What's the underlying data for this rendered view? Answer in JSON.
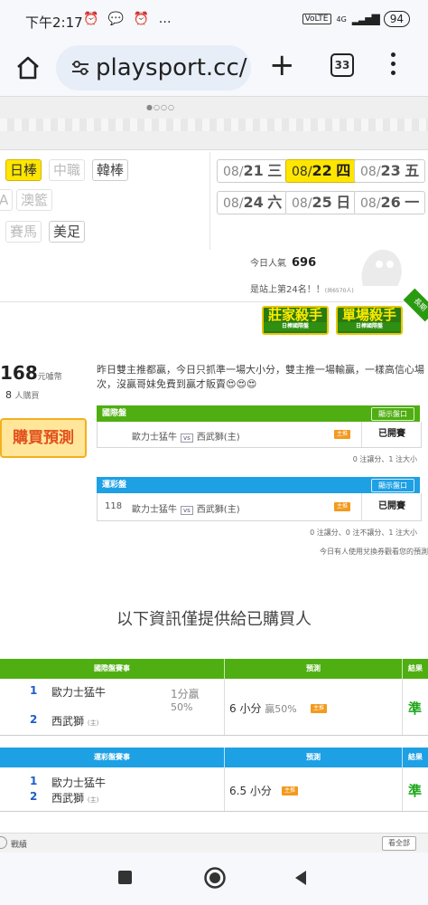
{
  "status": {
    "time": "下午2:17",
    "icons": "⏰ 💬 ⏰ …",
    "network": "4G",
    "battery": "94"
  },
  "browser": {
    "url": "playsport.cc/",
    "tab_count": "33"
  },
  "sports": {
    "row1": [
      "日棒",
      "中職",
      "韓棒"
    ],
    "row2": [
      "A",
      "澳籃"
    ],
    "row3": [
      "賽馬",
      "美足"
    ]
  },
  "dates": [
    {
      "md": "08/",
      "d": "21",
      "w": "三"
    },
    {
      "md": "08/",
      "d": "22",
      "w": "四"
    },
    {
      "md": "08/",
      "d": "23",
      "w": "五"
    },
    {
      "md": "08/",
      "d": "24",
      "w": "六"
    },
    {
      "md": "08/",
      "d": "25",
      "w": "日"
    },
    {
      "md": "08/",
      "d": "26",
      "w": "一"
    }
  ],
  "popularity": {
    "label": "今日人氣",
    "value": "696",
    "rank": "是站上第24名！！",
    "rank_small": "(共6570人)"
  },
  "ads": [
    {
      "title": "莊家殺手",
      "sub": "日棒國際盤"
    },
    {
      "title": "單場殺手",
      "sub": "日棒國際盤"
    }
  ],
  "corner_ribbon": "長期",
  "seller": {
    "price": "168",
    "price_unit": "元噱幣",
    "buyers": "8",
    "buyers_unit": "人購買",
    "buy_label": "購買預測"
  },
  "description": "昨日雙主推都贏，今日只抓準一場大小分，雙主推一場輸贏，一樣高信心場次，沒贏哥妹免費到贏才販賣😍😍😍",
  "intl_box": {
    "title": "國際盤",
    "show_label": "顯示盤口",
    "match": "歐力士猛牛",
    "vs": "vs",
    "match2": "西武獅(主)",
    "tag": "主推",
    "status": "已開賽",
    "note": "0 注讓分、1 注大小"
  },
  "lottery_box": {
    "title": "運彩盤",
    "show_label": "顯示盤口",
    "code": "118",
    "match": "歐力士猛牛",
    "vs": "vs",
    "match2": "西武獅(主)",
    "tag": "主推",
    "status": "已開賽",
    "note": "0 注讓分、0 注不讓分、1 注大小",
    "note2": "今日有人使用兌換券觀看您的預測"
  },
  "info_header": "以下資訊僅提供給已購買人",
  "table1": {
    "headers": [
      "國際盤賽事",
      "預測",
      "結果"
    ],
    "team1_no": "1",
    "team1": "歐力士猛牛",
    "line": "1分贏",
    "line_pct": "50%",
    "team2_no": "2",
    "team2": "西武獅",
    "home": "(主)",
    "prediction": "6 小分",
    "pred_extra": "贏50%",
    "tag": "主推",
    "result": "準"
  },
  "table2": {
    "headers": [
      "運彩盤賽事",
      "預測",
      "結果"
    ],
    "team1_no": "1",
    "team1": "歐力士猛牛",
    "team2_no": "2",
    "team2": "西武獅",
    "home": "(主)",
    "prediction": "6.5 小分",
    "tag": "主推",
    "result": "準"
  },
  "footer": {
    "label": "戰績",
    "all_label": "看全部"
  },
  "colors": {
    "accent_yellow": "#ffe600",
    "intl_green": "#4fae12",
    "lottery_blue": "#1ea0e4",
    "hit_green": "#21a81e",
    "buy_orange": "#e2501c"
  }
}
